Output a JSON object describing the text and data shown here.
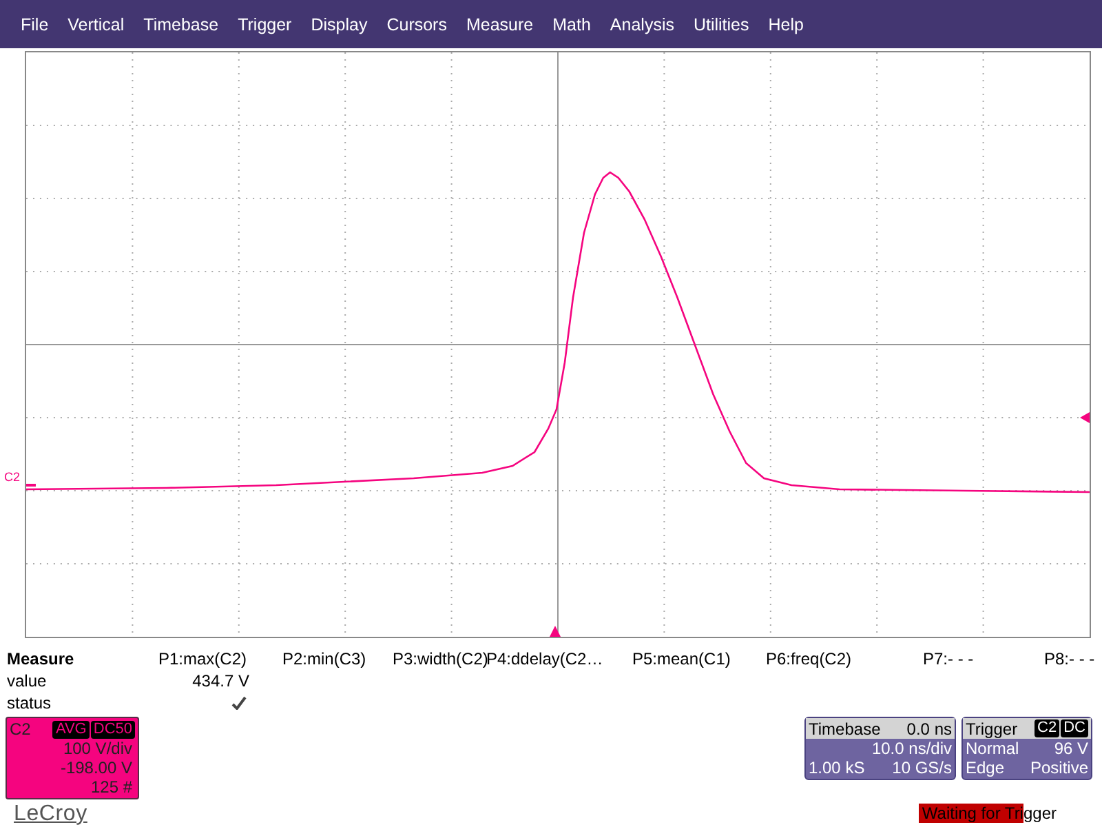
{
  "menu": [
    "File",
    "Vertical",
    "Timebase",
    "Trigger",
    "Display",
    "Cursors",
    "Measure",
    "Math",
    "Analysis",
    "Utilities",
    "Help"
  ],
  "scope": {
    "trace_label": "C2"
  },
  "measure": {
    "title": "Measure",
    "row_labels": [
      "value",
      "status"
    ],
    "params": [
      {
        "label": "P1:max(C2)",
        "value": "434.7 V",
        "status_ok": true
      },
      {
        "label": "P2:min(C3)",
        "status_ok": false
      },
      {
        "label": "P3:width(C2)",
        "status_ok": false
      },
      {
        "label": "P4:ddelay(C2…",
        "status_ok": false
      },
      {
        "label": "P5:mean(C1)",
        "status_ok": false
      },
      {
        "label": "P6:freq(C2)",
        "status_ok": false
      },
      {
        "label": "P7:- - -",
        "status_ok": false
      },
      {
        "label": "P8:- - -",
        "status_ok": false
      }
    ]
  },
  "channel": {
    "name": "C2",
    "color": "#f5047f",
    "tags": [
      "AVG",
      "DC50"
    ],
    "lines": [
      "100 V/div",
      "-198.00 V",
      "125 #"
    ]
  },
  "timebase": {
    "title": "Timebase",
    "delay": "0.0 ns",
    "scale": "10.0 ns/div",
    "samples": "1.00 kS",
    "rate": "10 GS/s"
  },
  "trigger": {
    "title": "Trigger",
    "tags": [
      "C2",
      "DC"
    ],
    "mode": "Normal",
    "level_text": "96 V",
    "type": "Edge",
    "slope": "Positive"
  },
  "logo": "LeCroy",
  "status": {
    "text": "Waiting for Trigger",
    "level": 0.74
  }
}
